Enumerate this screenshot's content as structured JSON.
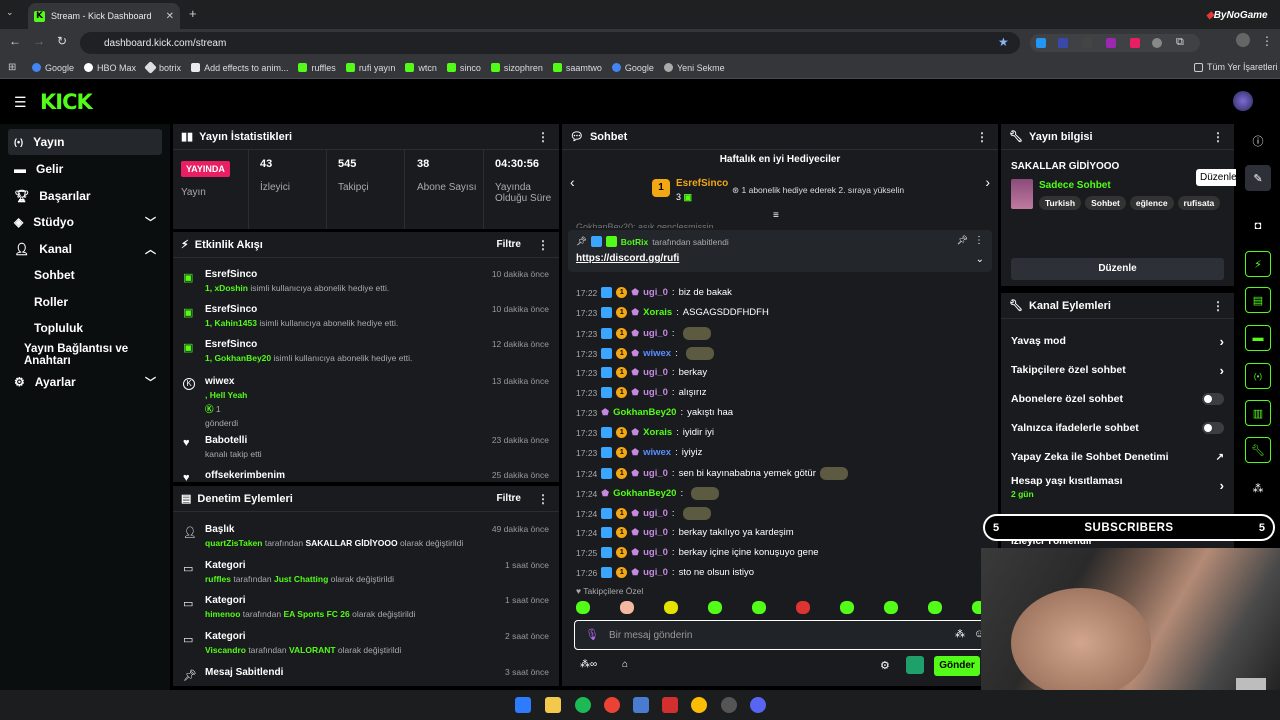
{
  "browser": {
    "tab_title": "Stream - Kick Dashboard",
    "url": "dashboard.kick.com/stream",
    "bookmarks": [
      "Google",
      "HBO Max",
      "botrix",
      "Add effects to anim...",
      "ruffles",
      "rufi yayın",
      "wtcn",
      "sinco",
      "sizophren",
      "saamtwo",
      "Google",
      "Yeni Sekme"
    ],
    "all_bookmarks": "Tüm Yer İşaretleri",
    "corner_brand": "ByNoGame"
  },
  "sidebar": {
    "items": [
      {
        "label": "Yayın",
        "icon": "broadcast-icon"
      },
      {
        "label": "Gelir",
        "icon": "money-icon"
      },
      {
        "label": "Başarılar",
        "icon": "trophy-icon"
      },
      {
        "label": "Stüdyo",
        "icon": "studio-icon"
      },
      {
        "label": "Kanal",
        "icon": "user-icon"
      },
      {
        "label": "Sohbet"
      },
      {
        "label": "Roller"
      },
      {
        "label": "Topluluk"
      },
      {
        "label": "Yayın Bağlantısı ve Anahtarı"
      },
      {
        "label": "Ayarlar",
        "icon": "gear-icon"
      }
    ]
  },
  "stats": {
    "title": "Yayın İstatistikleri",
    "live_badge": "YAYINDA",
    "status_label": "Yayın",
    "items": [
      {
        "value": "43",
        "label": "İzleyici"
      },
      {
        "value": "545",
        "label": "Takipçi"
      },
      {
        "value": "38",
        "label": "Abone Sayısı"
      },
      {
        "value": "04:30:56",
        "label": "Yayında Olduğu Süre"
      }
    ]
  },
  "activity": {
    "title": "Etkinlik Akışı",
    "filter": "Filtre",
    "events": [
      {
        "name": "EsrefSinco",
        "highlight": "1, xDoshin",
        "rest": " isimli kullanıcıya abonelik hediye etti.",
        "time": "10 dakika önce"
      },
      {
        "name": "EsrefSinco",
        "highlight": "1, Kahin1453",
        "rest": " isimli kullanıcıya abonelik hediye etti.",
        "time": "10 dakika önce"
      },
      {
        "name": "EsrefSinco",
        "highlight": "1, GokhanBey20",
        "rest": " isimli kullanıcıya abonelik hediye etti.",
        "time": "12 dakika önce"
      },
      {
        "name": "wiwex",
        "highlight": ", Hell Yeah",
        "extra": "1",
        "rest": "gönderdi",
        "time": "13 dakika önce"
      },
      {
        "name": "Babotelli",
        "highlight": "",
        "rest": "kanalı takip etti",
        "time": "23 dakika önce"
      },
      {
        "name": "offsekerimbenim",
        "highlight": "",
        "rest": "",
        "time": "25 dakika önce"
      }
    ]
  },
  "moderation": {
    "title": "Denetim Eylemleri",
    "filter": "Filtre",
    "items": [
      {
        "type": "Başlık",
        "user": "quartZisTaken",
        "mid": " tarafından ",
        "value": "SAKALLAR GİDİYOOO",
        "end": " olarak değiştirildi",
        "time": "49 dakika önce"
      },
      {
        "type": "Kategori",
        "user": "ruffles",
        "mid": " tarafından ",
        "value": "Just Chatting",
        "end": " olarak değiştirildi",
        "time": "1 saat önce"
      },
      {
        "type": "Kategori",
        "user": "himenoo",
        "mid": " tarafından ",
        "value": "EA Sports FC 26",
        "end": " olarak değiştirildi",
        "time": "1 saat önce"
      },
      {
        "type": "Kategori",
        "user": "Viscandro",
        "mid": " tarafından ",
        "value": "VALORANT",
        "end": " olarak değiştirildi",
        "time": "2 saat önce"
      },
      {
        "type": "Mesaj Sabitlendi",
        "user": "",
        "mid": "",
        "value": "",
        "end": "",
        "time": "3 saat önce"
      }
    ]
  },
  "chat": {
    "title": "Sohbet",
    "top_gifters": "Haftalık en iyi Hediyeciler",
    "gifter_name": "EsrefSinco",
    "gifter_rank": "1",
    "gifter_count": "3",
    "gifter_hint": "1 abonelik hediye ederek 2. sıraya yükselin",
    "partial_msg": "GokhanBey20: asık gençleşmişsin",
    "pinned_by": "BotRix",
    "pinned_suffix": " tarafından sabitlendi",
    "pinned_link": "https://discord.gg/rufi",
    "messages": [
      {
        "time": "17:22",
        "user": "ugi_0",
        "color": "#c58ae0",
        "text": "biz de bakak"
      },
      {
        "time": "17:23",
        "user": "Xorais",
        "color": "#53fc18",
        "text": "ASGAGSDDFHDFH"
      },
      {
        "time": "17:23",
        "user": "ugi_0",
        "color": "#c58ae0",
        "text": "",
        "emote": true
      },
      {
        "time": "17:23",
        "user": "wiwex",
        "color": "#5b8cff",
        "text": "",
        "emote": true
      },
      {
        "time": "17:23",
        "user": "ugi_0",
        "color": "#c58ae0",
        "text": "berkay"
      },
      {
        "time": "17:23",
        "user": "ugi_0",
        "color": "#c58ae0",
        "text": "alışırız"
      },
      {
        "time": "17:23",
        "user": "GokhanBey20",
        "color": "#53fc18",
        "text": "yakıştı haa"
      },
      {
        "time": "17:23",
        "user": "Xorais",
        "color": "#53fc18",
        "text": "iyidir iyi"
      },
      {
        "time": "17:23",
        "user": "wiwex",
        "color": "#5b8cff",
        "text": "iyiyiz"
      },
      {
        "time": "17:24",
        "user": "ugi_0",
        "color": "#c58ae0",
        "text": "sen bi kayınababna yemek götür",
        "emote": true
      },
      {
        "time": "17:24",
        "user": "GokhanBey20",
        "color": "#53fc18",
        "text": "",
        "emote": true
      },
      {
        "time": "17:24",
        "user": "ugi_0",
        "color": "#c58ae0",
        "text": "",
        "emote": true
      },
      {
        "time": "17:24",
        "user": "ugi_0",
        "color": "#c58ae0",
        "text": "berkay takılıyo ya kardeşim"
      },
      {
        "time": "17:25",
        "user": "ugi_0",
        "color": "#c58ae0",
        "text": "berkay içine içine konuşuyo gene"
      },
      {
        "time": "17:26",
        "user": "ugi_0",
        "color": "#c58ae0",
        "text": "sto ne olsun istiyo"
      }
    ],
    "followers_only": "Takipçilere Özel",
    "input_placeholder": "Bir mesaj gönderin",
    "send_label": "Gönder"
  },
  "streaminfo": {
    "title": "Yayın bilgisi",
    "stream_title": "SAKALLAR GİDİYOOO",
    "category": "Sadece Sohbet",
    "tags": [
      "Turkish",
      "Sohbet",
      "eğlence",
      "rufisata"
    ],
    "edit_label": "Düzenle",
    "tooltip": "Düzenle"
  },
  "channel_actions": {
    "title": "Kanal Eylemleri",
    "rows": [
      {
        "label": "Yavaş mod",
        "kind": "arrow"
      },
      {
        "label": "Takipçilere özel sohbet",
        "kind": "arrow"
      },
      {
        "label": "Abonelere özel sohbet",
        "kind": "toggle"
      },
      {
        "label": "Yalnızca ifadelerle sohbet",
        "kind": "toggle"
      },
      {
        "label": "Yapay Zeka ile Sohbet Denetimi",
        "kind": "link"
      },
      {
        "label": "Hesap yaşı kısıtlaması",
        "sub": "2 gün",
        "kind": "arrow"
      }
    ],
    "partial_row": "İzleyici Yönlendir"
  },
  "overlay": {
    "left_count": "5",
    "label": "SUBSCRIBERS",
    "right_count": "5"
  }
}
